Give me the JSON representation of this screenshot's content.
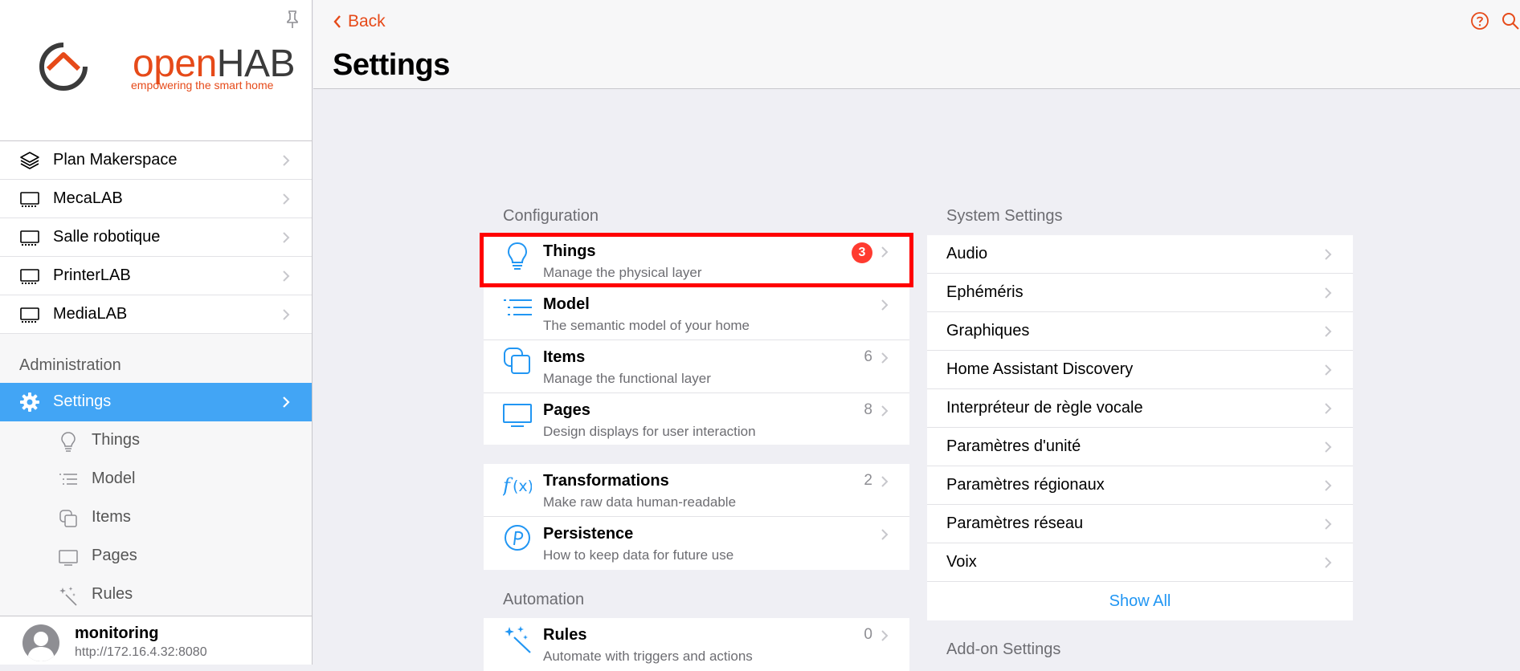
{
  "app": {
    "logo_word_open": "open",
    "logo_word_hab": "HAB",
    "logo_tagline": "empowering the smart home",
    "accent_color": "#e64a19",
    "selected_color": "#42a5f5"
  },
  "sidebar": {
    "pin_icon": "pin-icon",
    "pages": [
      {
        "label": "Plan Makerspace",
        "icon": "layers-icon"
      },
      {
        "label": "MecaLAB",
        "icon": "tv-icon"
      },
      {
        "label": "Salle robotique",
        "icon": "tv-icon"
      },
      {
        "label": "PrinterLAB",
        "icon": "tv-icon"
      },
      {
        "label": "MediaLAB",
        "icon": "tv-icon"
      }
    ],
    "admin_title": "Administration",
    "settings_label": "Settings",
    "sub_items": [
      {
        "label": "Things",
        "icon": "lightbulb-icon"
      },
      {
        "label": "Model",
        "icon": "list-icon"
      },
      {
        "label": "Items",
        "icon": "squares-icon"
      },
      {
        "label": "Pages",
        "icon": "tv-icon"
      },
      {
        "label": "Rules",
        "icon": "wand-icon"
      }
    ],
    "user": {
      "name": "monitoring",
      "url": "http://172.16.4.32:8080"
    }
  },
  "topbar": {
    "back_label": "Back",
    "title": "Settings"
  },
  "configuration": {
    "title": "Configuration",
    "items": [
      {
        "title": "Things",
        "subtitle": "Manage the physical layer",
        "badge": "3",
        "icon": "lightbulb-icon"
      },
      {
        "title": "Model",
        "subtitle": "The semantic model of your home",
        "count": "",
        "icon": "list-icon"
      },
      {
        "title": "Items",
        "subtitle": "Manage the functional layer",
        "count": "6",
        "icon": "squares-icon"
      },
      {
        "title": "Pages",
        "subtitle": "Design displays for user interaction",
        "count": "8",
        "icon": "tv-icon"
      }
    ],
    "items2": [
      {
        "title": "Transformations",
        "subtitle": "Make raw data human-readable",
        "count": "2",
        "icon": "function-icon"
      },
      {
        "title": "Persistence",
        "subtitle": "How to keep data for future use",
        "count": "",
        "icon": "persistence-icon"
      }
    ]
  },
  "automation": {
    "title": "Automation",
    "items": [
      {
        "title": "Rules",
        "subtitle": "Automate with triggers and actions",
        "count": "0",
        "icon": "wand-icon"
      }
    ]
  },
  "system_settings": {
    "title": "System Settings",
    "items": [
      "Audio",
      "Ephéméris",
      "Graphiques",
      "Home Assistant Discovery",
      "Interpréteur de règle vocale",
      "Paramètres d'unité",
      "Paramètres régionaux",
      "Paramètres réseau",
      "Voix"
    ],
    "show_all": "Show All"
  },
  "addon_settings": {
    "title": "Add-on Settings"
  }
}
